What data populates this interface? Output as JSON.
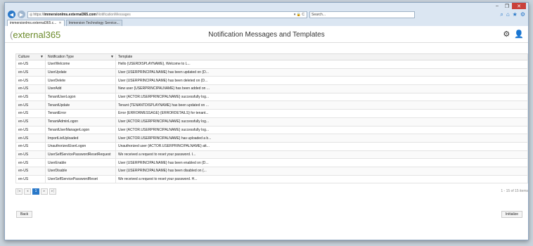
{
  "browser": {
    "window_controls": {
      "minimize": "–",
      "maximize": "❐",
      "close": "✕"
    },
    "url_https": "https://",
    "url_host": "immersionlms.external365.com",
    "url_path": "/NotificationMessages",
    "url_icons": "▾ 🔒 C",
    "search_placeholder": "Search...",
    "tabs": [
      {
        "label": "immersionlms.external365.c...",
        "active": true
      },
      {
        "label": "Immersion Technology Service...",
        "active": false
      }
    ]
  },
  "app": {
    "logo_open": "(",
    "logo_text": "external365",
    "title": "Notification Messages and Templates"
  },
  "grid": {
    "columns": [
      "Culture",
      "Notification Type",
      "Template"
    ],
    "rows": [
      [
        "en-US",
        "UserWelcome",
        "Hello {USERDISPLAYNAME}, Welcome to L..."
      ],
      [
        "en-US",
        "UserUpdate",
        "User {USERPRINCIPALNAME} has been updated on {D..."
      ],
      [
        "en-US",
        "UserDelete",
        "User {USERPRINCIPALNAME} has been deleted on {D..."
      ],
      [
        "en-US",
        "UserAdd",
        "New user {USERPRINCIPALNAME} has been added on ..."
      ],
      [
        "en-US",
        "TenantUserLogon",
        "User {ACTOR.USERPRINCIPALNAME} successfully log..."
      ],
      [
        "en-US",
        "TenantUpdate",
        "Tenant {TENANTDISPLAYNAME} has been updated on ..."
      ],
      [
        "en-US",
        "TenantError",
        "Error {ERRORMESSAGE} {ERRORDETAILS} for tenant..."
      ],
      [
        "en-US",
        "TenantAdminLogon",
        "User {ACTOR.USERPRINCIPALNAME} successfully log..."
      ],
      [
        "en-US",
        "TenantUserManagerLogon",
        "User {ACTOR.USERPRINCIPALNAME} successfully log..."
      ],
      [
        "en-US",
        "ImportListUploaded",
        "User {ACTOR.USERPRINCIPALNAME} has uploaded a b..."
      ],
      [
        "en-US",
        "UnauthorizedUserLogon",
        "Unauthorized user {ACTOR.USERPRINCIPALNAME} att..."
      ],
      [
        "en-US",
        "UserSelfServicePasswordResetRequest",
        "We received a request to reset your password. I..."
      ],
      [
        "en-US",
        "UserEnable",
        "User {USERPRINCIPALNAME} has been enabled on {D..."
      ],
      [
        "en-US",
        "UserDisable",
        "User {USERPRINCIPALNAME} has been disabled on {..."
      ],
      [
        "en-US",
        "UserSelfServicePasswordReset",
        "We received a request to reset your password. H..."
      ]
    ]
  },
  "pager": {
    "first": "|◂",
    "prev": "◂",
    "current": "1",
    "next": "▸",
    "last": "▸|",
    "info": "1 - 15 of 15 items"
  },
  "buttons": {
    "back": "Back",
    "initialize": "Initialize"
  }
}
